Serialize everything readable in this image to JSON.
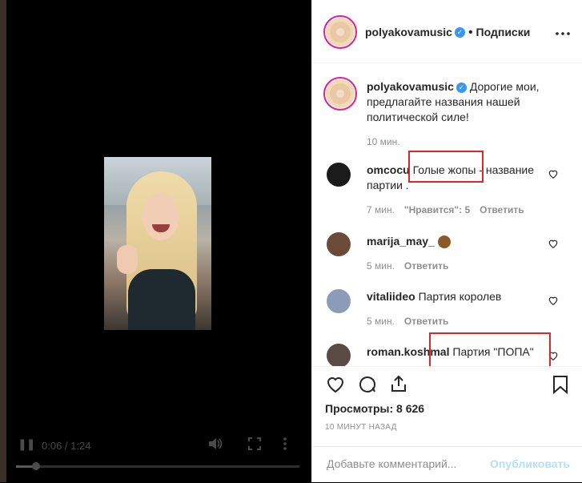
{
  "player": {
    "current_time": "0:06",
    "duration": "1:24",
    "time_separator": " / ",
    "progress_fraction": 0.07
  },
  "post": {
    "author": "polyakovamusic",
    "follow_label": "Подписки",
    "caption_author": "polyakovamusic",
    "caption": "Дорогие мои, предлагайте названия нашей политической силе!",
    "caption_time": "10 мин."
  },
  "comments": [
    {
      "user": "omcocu",
      "text": "Голые жопы - название партии .",
      "time": "7 мин.",
      "likes": "\"Нравится\": 5",
      "reply": "Ответить"
    },
    {
      "user": "marija_may_",
      "text": "",
      "time": "5 мин.",
      "reply": "Ответить"
    },
    {
      "user": "vitaliideo",
      "text": "Партия королев",
      "time": "5 мин.",
      "reply": "Ответить"
    },
    {
      "user": "roman.koshmal",
      "text": "Партия \"ПОПА\""
    }
  ],
  "stats": {
    "views": "Просмотры: 8 626",
    "ago": "10 МИНУТ НАЗАД"
  },
  "composer": {
    "placeholder": "Добавьте комментарий...",
    "publish_label": "Опубликовать"
  },
  "colors": {
    "brand_blue": "#3897f0",
    "highlight_red": "#d42a2a",
    "publish_disabled": "#b2dffc"
  }
}
